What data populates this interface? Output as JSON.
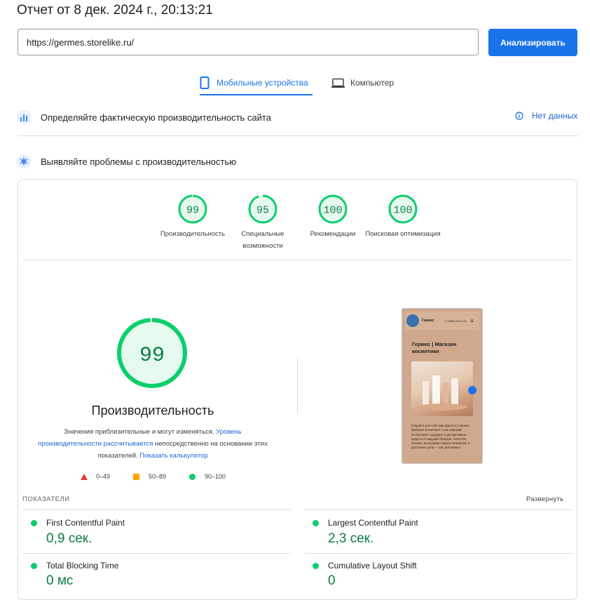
{
  "report_title": "Отчет от 8 дек. 2024 г., 20:13:21",
  "url_input": {
    "value": "https://germes.storelike.ru/",
    "placeholder": ""
  },
  "analyze_button": "Анализировать",
  "tabs": [
    {
      "label": "Мобильные устройства",
      "icon": "mobile-icon",
      "active": true
    },
    {
      "label": "Компьютер",
      "icon": "desktop-icon",
      "active": false
    }
  ],
  "field_section": {
    "title": "Определяйте фактическую производительность сайта",
    "status": "Нет данных"
  },
  "lab_section": {
    "title": "Выявляйте проблемы с производительностью"
  },
  "scores": [
    {
      "value": 99,
      "label": "Производительность",
      "fraction": 0.99
    },
    {
      "value": 95,
      "label": "Специальные возможности",
      "fraction": 0.95
    },
    {
      "value": 100,
      "label": "Рекомендации",
      "fraction": 1.0
    },
    {
      "value": 100,
      "label": "Поисковая оптимизация",
      "fraction": 1.0
    }
  ],
  "main_score": {
    "value": 99,
    "label": "Производительность",
    "fraction": 0.99
  },
  "note": {
    "text1": "Значения приблизительные и могут изменяться.",
    "link1": "Уровень производительности рассчитывается",
    "text2": "непосредственно на основании этих показателей.",
    "link2": "Показать калькулятор"
  },
  "legend": [
    {
      "range": "0–49",
      "color": "#e53935",
      "shape": "triangle"
    },
    {
      "range": "50–89",
      "color": "#ffa400",
      "shape": "square"
    },
    {
      "range": "90–100",
      "color": "#0cce6b",
      "shape": "circle"
    }
  ],
  "phone_preview": {
    "brand": "Гермес",
    "phone": "+7 (999) 010 5 76",
    "heading": "Гермес | Магазин косметики",
    "body": "Откройте для себя мир красоты в нашем магазине косметики! У нас широкий ассортимент уходовых и декоративных средств от ведущих брендов. Качество, которое заслуживает вашего внимания, и доступные цены — все для вашего"
  },
  "metrics_label": "ПОКАЗАТЕЛИ",
  "expand_label": "Развернуть",
  "metrics": [
    {
      "name": "First Contentful Paint",
      "value": "0,9 сек.",
      "status_color": "#0cce6b"
    },
    {
      "name": "Largest Contentful Paint",
      "value": "2,3 сек.",
      "status_color": "#0cce6b"
    },
    {
      "name": "Total Blocking Time",
      "value": "0 мс",
      "status_color": "#0cce6b"
    },
    {
      "name": "Cumulative Layout Shift",
      "value": "0",
      "status_color": "#0cce6b"
    }
  ],
  "colors": {
    "accent": "#1a73e8",
    "pass": "#0cce6b",
    "pass_text": "#0b8043",
    "pass_bg": "#e6f9ef"
  }
}
